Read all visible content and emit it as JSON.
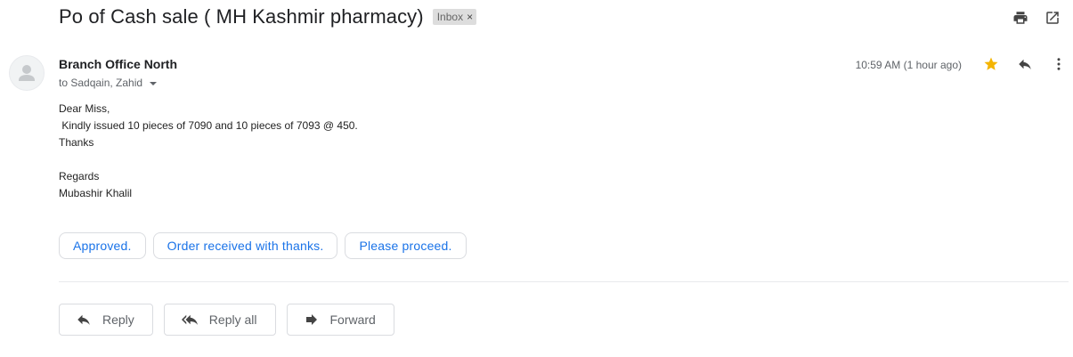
{
  "thread": {
    "subject": "Po of Cash sale ( MH Kashmir pharmacy)",
    "label": "Inbox",
    "label_remove_glyph": "×"
  },
  "top_actions": {
    "print_icon": "print-icon",
    "open_new_window_icon": "open-in-new-window-icon"
  },
  "message": {
    "sender": "Branch Office North",
    "recipients": "to Sadqain, Zahid",
    "timestamp": "10:59 AM (1 hour ago)",
    "starred": true,
    "star_color": "#f4b400",
    "body": "Dear Miss,\n Kindly issued 10 pieces of 7090 and 10 pieces of 7093 @ 450.\nThanks\n\nRegards\nMubashir Khalil"
  },
  "smart_replies": [
    "Approved.",
    "Order received with thanks.",
    "Please proceed."
  ],
  "actions": {
    "reply": "Reply",
    "reply_all": "Reply all",
    "forward": "Forward"
  },
  "colors": {
    "accent": "#1a73e8",
    "chip_border": "#dadce0",
    "muted_text": "#5f6368"
  }
}
